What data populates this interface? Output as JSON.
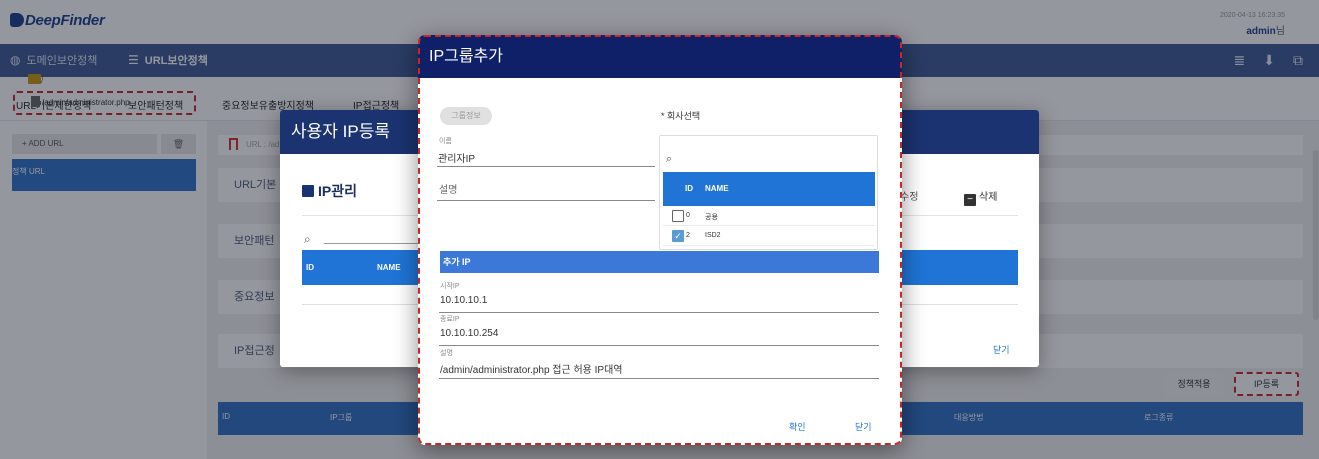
{
  "app": {
    "logo": "DeepFinder",
    "datetime": "2020-04-13 16:23:35",
    "user": "admin",
    "user_suffix": "님"
  },
  "nav": {
    "items": [
      {
        "label": "도메인보안정책",
        "icon": "globe-icon"
      },
      {
        "label": "URL보안정책",
        "icon": "list-icon"
      }
    ],
    "right_icons": [
      "menu-lines-icon",
      "download-icon",
      "copy-icon"
    ]
  },
  "subtabs": [
    "URL기본제한정책",
    "보안패턴정책",
    "중요정보유출방지정책",
    "IP접근정책"
  ],
  "left": {
    "add_url": "+ ADD URL",
    "trash": "🗑",
    "tree_header": "정책 URL",
    "folder": "/",
    "file": "/admin/administrator.php"
  },
  "main": {
    "url_bar": "URL : /ad",
    "cards": [
      "URL기본",
      "보안패턴",
      "중요정보",
      "IP접근정"
    ],
    "policy_apply_btn": "정책적용",
    "ip_register_btn": "IP등록",
    "table_headers": [
      "ID",
      "IP그룹",
      "대응방법",
      "로그종류"
    ]
  },
  "ip_modal": {
    "title": "사용자 IP등록",
    "section_title": "IP관리",
    "edit_label": "수정",
    "delete_label": "삭제",
    "table_headers": [
      "ID",
      "NAME"
    ],
    "close": "닫기"
  },
  "group_modal": {
    "title": "IP그룹추가",
    "group_info_chip": "그룹정보",
    "company_select_label": "* 회사선택",
    "name_label": "이름",
    "name_value": "관리자IP",
    "desc_placeholder": "설명",
    "company_table_headers": [
      "ID",
      "NAME"
    ],
    "companies": [
      {
        "id": "0",
        "name": "공용",
        "checked": false
      },
      {
        "id": "2",
        "name": "ISD2",
        "checked": true
      }
    ],
    "add_ip_label": "추가 IP",
    "start_ip_label": "시작IP",
    "start_ip_value": "10.10.10.1",
    "end_ip_label": "종료IP",
    "end_ip_value": "10.10.10.254",
    "desc_label": "설명",
    "desc_value": "/admin/administrator.php 접근 허용 IP대역",
    "confirm": "확인",
    "close": "닫기"
  }
}
